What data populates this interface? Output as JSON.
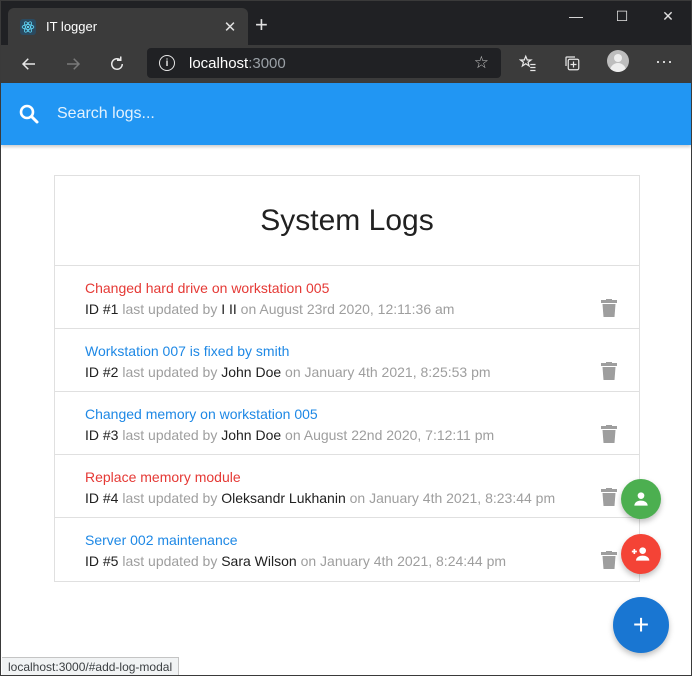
{
  "browser": {
    "tab_title": "IT logger",
    "tab_close": "✕",
    "new_tab": "+",
    "url_host": "localhost",
    "url_port": ":3000",
    "window_controls": [
      "—",
      "☐",
      "✕"
    ],
    "status_text": "localhost:3000/#add-log-modal"
  },
  "search": {
    "placeholder": "Search logs..."
  },
  "logs_section": {
    "title": "System Logs",
    "items": [
      {
        "message": "Changed hard drive on workstation 005",
        "attention": true,
        "id_label": "ID #1",
        "updated_text": "last updated by",
        "tech": "I II",
        "date_text": "on August 23rd 2020, 12:11:36 am"
      },
      {
        "message": "Workstation 007 is fixed by smith",
        "attention": false,
        "id_label": "ID #2",
        "updated_text": "last updated by",
        "tech": "John Doe",
        "date_text": "on January 4th 2021, 8:25:53 pm"
      },
      {
        "message": "Changed memory on workstation 005",
        "attention": false,
        "id_label": "ID #3",
        "updated_text": "last updated by",
        "tech": "John Doe",
        "date_text": "on August 22nd 2020, 7:12:11 pm"
      },
      {
        "message": "Replace memory module",
        "attention": true,
        "id_label": "ID #4",
        "updated_text": "last updated by",
        "tech": "Oleksandr Lukhanin",
        "date_text": "on January 4th 2021, 8:23:44 pm"
      },
      {
        "message": "Server 002 maintenance",
        "attention": false,
        "id_label": "ID #5",
        "updated_text": "last updated by",
        "tech": "Sara Wilson",
        "date_text": "on January 4th 2021, 8:24:44 pm"
      }
    ]
  },
  "colors": {
    "nav": "#2196f3",
    "attention": "#e53935",
    "normal": "#1e88e5",
    "fab_main": "#1976d2",
    "fab_green": "#4caf50",
    "fab_red": "#f44336"
  },
  "fab": {
    "main_icon": "+"
  }
}
